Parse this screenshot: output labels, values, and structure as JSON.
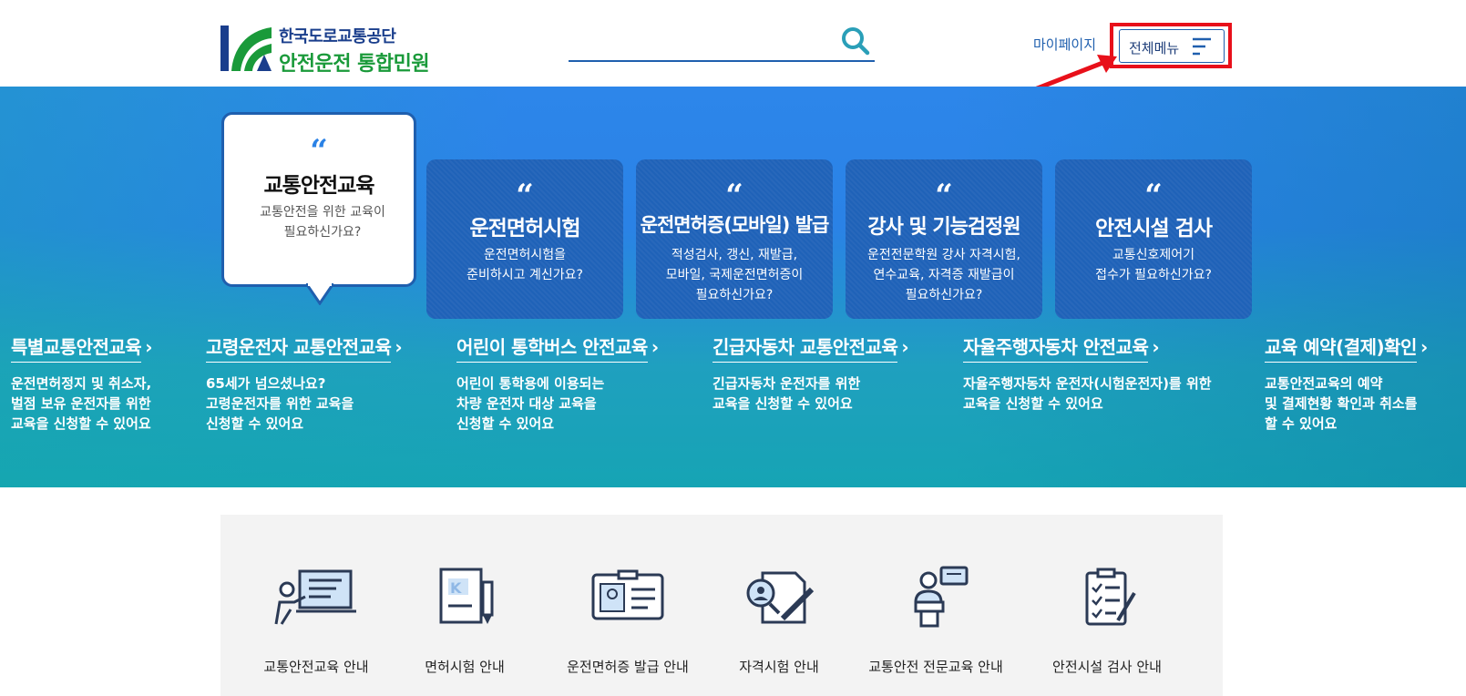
{
  "header": {
    "logo_line1": "한국도로교통공단",
    "logo_line2": "안전운전 통합민원",
    "search_placeholder": "",
    "mypage_label": "마이페이지",
    "allmenu_label": "전체메뉴"
  },
  "cards": [
    {
      "quote": "“",
      "title": "교통안전교육",
      "desc": "교통안전을 위한 교육이\n필요하신가요?"
    },
    {
      "quote": "“",
      "title": "운전면허시험",
      "desc": "운전면허시험을\n준비하시고 계신가요?"
    },
    {
      "quote": "“",
      "title": "운전면허증(모바일) 발급",
      "desc": "적성검사, 갱신, 재발급,\n모바일, 국제운전면허증이\n필요하신가요?"
    },
    {
      "quote": "“",
      "title": "강사 및 기능검정원",
      "desc": "운전전문학원 강사 자격시험,\n연수교육, 자격증 재발급이\n필요하신가요?"
    },
    {
      "quote": "“",
      "title": "안전시설 검사",
      "desc": "교통신호제어기\n접수가 필요하신가요?"
    }
  ],
  "links": [
    {
      "title": "특별교통안전교육",
      "desc": "운전면허정지 및 취소자,\n벌점 보유 운전자를 위한\n교육을 신청할 수 있어요"
    },
    {
      "title": "고령운전자 교통안전교육",
      "desc": "65세가 넘으셨나요?\n고령운전자를 위한 교육을\n신청할 수 있어요"
    },
    {
      "title": "어린이 통학버스 안전교육",
      "desc": "어린이 통학용에 이용되는\n차량 운전자 대상 교육을\n신청할 수 있어요"
    },
    {
      "title": "긴급자동차 교통안전교육",
      "desc": "긴급자동차 운전자를 위한\n교육을 신청할 수 있어요"
    },
    {
      "title": "자율주행자동차 안전교육",
      "desc": "자율주행자동차 운전자(시험운전자)를 위한\n교육을 신청할 수 있어요"
    },
    {
      "title": "교육 예약(결제)확인",
      "desc": "교통안전교육의 예약\n및 결제현황 확인과 취소를\n할 수 있어요"
    }
  ],
  "guide": [
    {
      "label": "교통안전교육 안내",
      "icon": "lecture-icon"
    },
    {
      "label": "면허시험 안내",
      "icon": "license-book-icon"
    },
    {
      "label": "운전면허증 발급 안내",
      "icon": "id-card-icon"
    },
    {
      "label": "자격시험 안내",
      "icon": "exam-icon"
    },
    {
      "label": "교통안전 전문교육 안내",
      "icon": "speaker-icon"
    },
    {
      "label": "안전시설 검사 안내",
      "icon": "checklist-icon"
    }
  ],
  "colors": {
    "brand_blue": "#1f5fae",
    "brand_green": "#1a9a3a",
    "highlight_red": "#e8101a"
  }
}
